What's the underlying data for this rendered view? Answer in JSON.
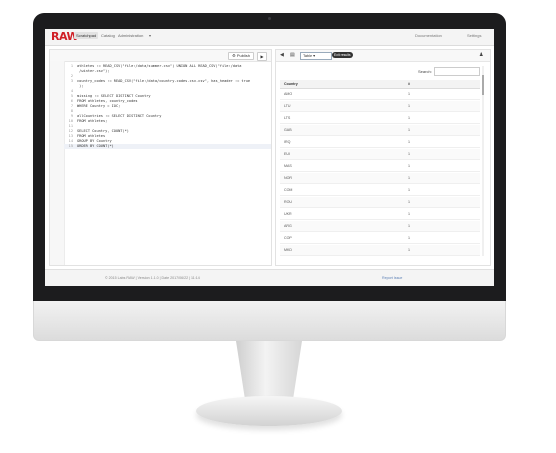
{
  "app": {
    "logo": "RAW",
    "accent": "#d01f26"
  },
  "nav": {
    "items": [
      "Scratchpad",
      "Catalog",
      "Administration"
    ],
    "active_index": 0,
    "right": [
      "Documentation",
      "Settings"
    ]
  },
  "editor": {
    "publish_label": "Publish",
    "run_icon": "play-icon",
    "lines": [
      {
        "n": "1",
        "text": "athletes := READ_CSV(\"file:/data/summer.csv\") UNION ALL READ_CSV(\"file:/data"
      },
      {
        "n": "",
        "text": "    /winter.csv\");"
      },
      {
        "n": "2",
        "text": ""
      },
      {
        "n": "3",
        "text": "country_codes := READ_CSV(\"file:/data/country-codes.csv.csv\", has_header := true"
      },
      {
        "n": "",
        "text": "    );"
      },
      {
        "n": "4",
        "text": ""
      },
      {
        "n": "5",
        "text": "missing := SELECT DISTINCT Country"
      },
      {
        "n": "6",
        "text": "FROM athletes, country_codes"
      },
      {
        "n": "7",
        "text": "WHERE Country = IOC;"
      },
      {
        "n": "8",
        "text": ""
      },
      {
        "n": "9",
        "text": "allCountries := SELECT DISTINCT Country"
      },
      {
        "n": "10",
        "text": "FROM athletes;"
      },
      {
        "n": "11",
        "text": ""
      },
      {
        "n": "12",
        "text": "SELECT Country, COUNT(*)"
      },
      {
        "n": "13",
        "text": "FROM athletes"
      },
      {
        "n": "14",
        "text": "GROUP BY Country"
      },
      {
        "n": "15",
        "text": "ORDER BY COUNT(*)"
      }
    ]
  },
  "results": {
    "format_label": "Table",
    "badge": "Exit results",
    "search_label": "Search:",
    "columns": [
      "Country",
      "#"
    ],
    "rows": [
      {
        "country": "AMO",
        "count": "1"
      },
      {
        "country": "LTU",
        "count": "1"
      },
      {
        "country": "LTS",
        "count": "1"
      },
      {
        "country": "GAB",
        "count": "1"
      },
      {
        "country": "IRQ",
        "count": "1"
      },
      {
        "country": "EUI",
        "count": "1"
      },
      {
        "country": "MAS",
        "count": "1"
      },
      {
        "country": "NOR",
        "count": "1"
      },
      {
        "country": "COM",
        "count": "1"
      },
      {
        "country": "ROU",
        "count": "1"
      },
      {
        "country": "UKR",
        "count": "1"
      },
      {
        "country": "ARG",
        "count": "1"
      },
      {
        "country": "COP",
        "count": "1"
      },
      {
        "country": "MKD",
        "count": "1"
      }
    ]
  },
  "footer": {
    "copyright": "© 2015 Labs RAW | Version 1.1.0 | Date 2017/06/22 | 11:14",
    "report": "Report Issue"
  }
}
